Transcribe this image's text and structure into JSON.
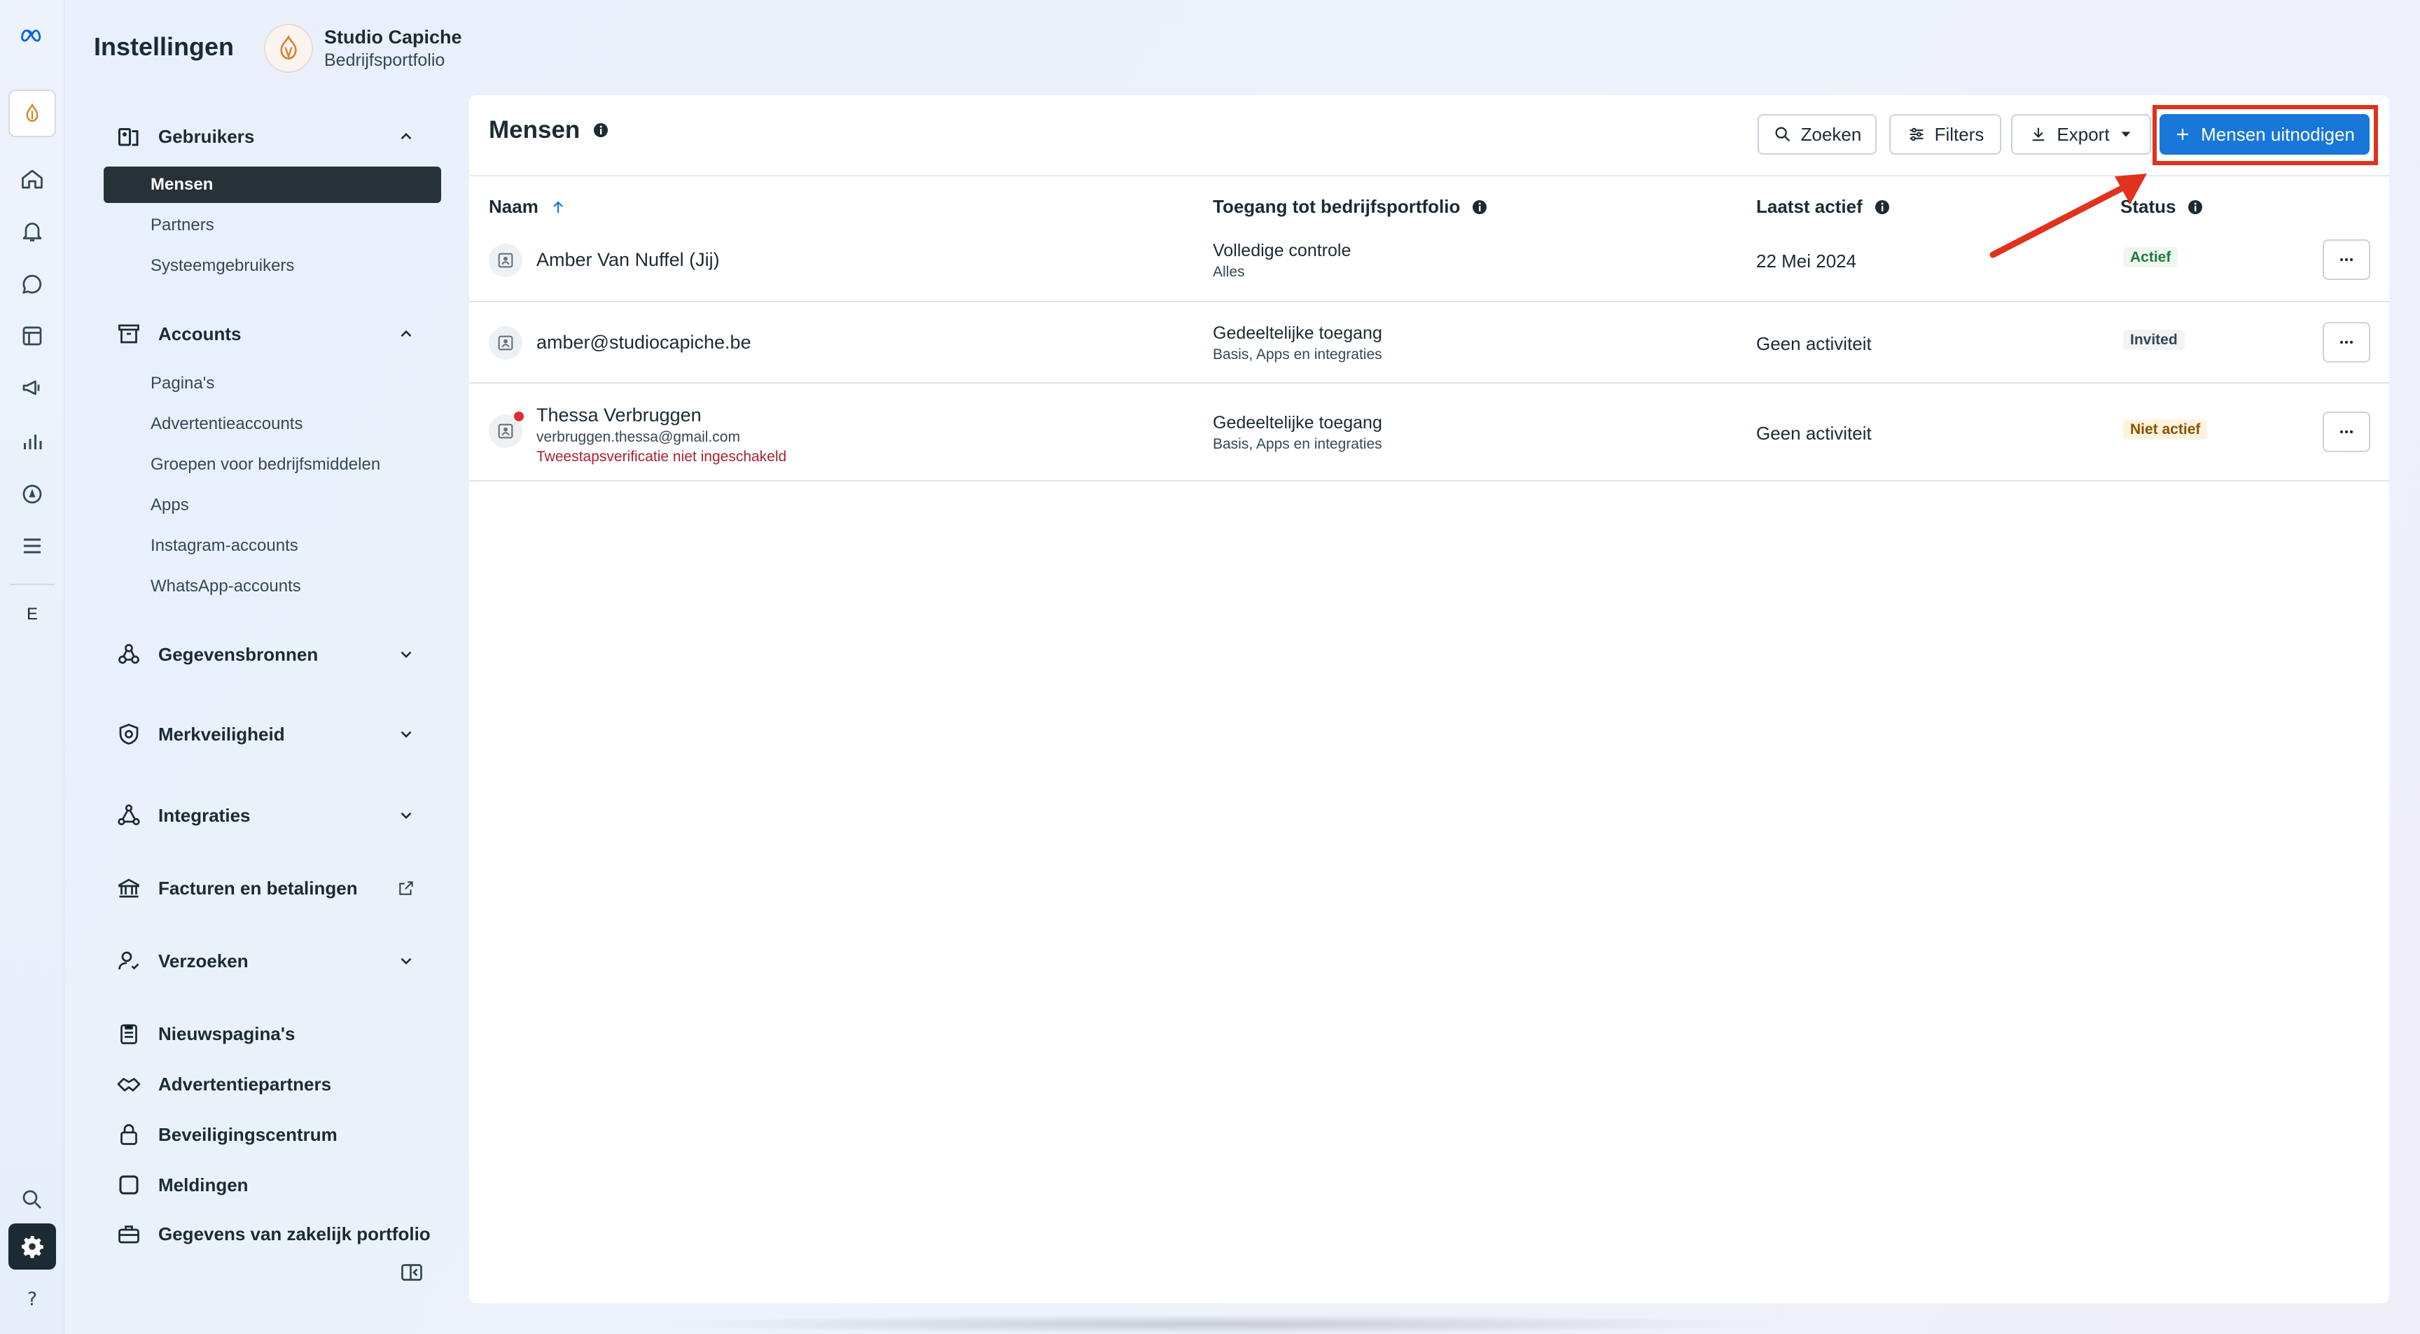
{
  "topbar": {
    "title": "Instellingen",
    "portfolio_name": "Studio Capiche",
    "portfolio_sub": "Bedrijfsportfolio"
  },
  "rail": {
    "letter": "E",
    "icons": [
      "meta-logo-icon",
      "home-icon",
      "bell-icon",
      "chat-icon",
      "pages-icon",
      "megaphone-icon",
      "bar-chart-icon",
      "compass-icon",
      "menu-icon",
      "search-icon",
      "settings-icon",
      "help-icon"
    ]
  },
  "sidebar": {
    "users": {
      "label": "Gebruikers",
      "items": [
        "Mensen",
        "Partners",
        "Systeemgebruikers"
      ]
    },
    "accounts": {
      "label": "Accounts",
      "items": [
        "Pagina's",
        "Advertentieaccounts",
        "Groepen voor bedrijfsmiddelen",
        "Apps",
        "Instagram-accounts",
        "WhatsApp-accounts"
      ]
    },
    "sections": {
      "data_sources": "Gegevensbronnen",
      "brand_safety": "Merkveiligheid",
      "integrations": "Integraties",
      "billing": "Facturen en betalingen",
      "requests": "Verzoeken",
      "newsfeeds": "Nieuwspagina's",
      "ad_partners": "Advertentiepartners",
      "security_center": "Beveiligingscentrum",
      "notifications": "Meldingen",
      "business_info": "Gegevens van zakelijk portfolio"
    }
  },
  "main": {
    "title": "Mensen",
    "search_label": "Zoeken",
    "filters_label": "Filters",
    "export_label": "Export",
    "invite_label": "Mensen uitnodigen",
    "columns": {
      "name": "Naam",
      "access": "Toegang tot bedrijfsportfolio",
      "last_active": "Laatst actief",
      "status": "Status"
    },
    "rows": [
      {
        "name": "Amber Van Nuffel (Jij)",
        "email": "",
        "warning": "",
        "access": "Volledige controle",
        "access_sub": "Alles",
        "last_active": "22 Mei 2024",
        "status": "Actief",
        "status_color": "#1f7a3a"
      },
      {
        "name": "amber@studiocapiche.be",
        "email": "",
        "warning": "",
        "access": "Gedeeltelijke toegang",
        "access_sub": "Basis, Apps en integraties",
        "last_active": "Geen activiteit",
        "status": "Invited",
        "status_color": "#344854"
      },
      {
        "name": "Thessa Verbruggen",
        "email": "verbruggen.thessa@gmail.com",
        "warning": "Tweestapsverificatie niet ingeschakeld",
        "access": "Gedeeltelijke toegang",
        "access_sub": "Basis, Apps en integraties",
        "last_active": "Geen activiteit",
        "status": "Niet actief",
        "status_color": "#8a5200"
      }
    ]
  },
  "colors": {
    "primary": "#1877d8",
    "highlight": "#e0321d",
    "sidebar_active": "#263238"
  }
}
